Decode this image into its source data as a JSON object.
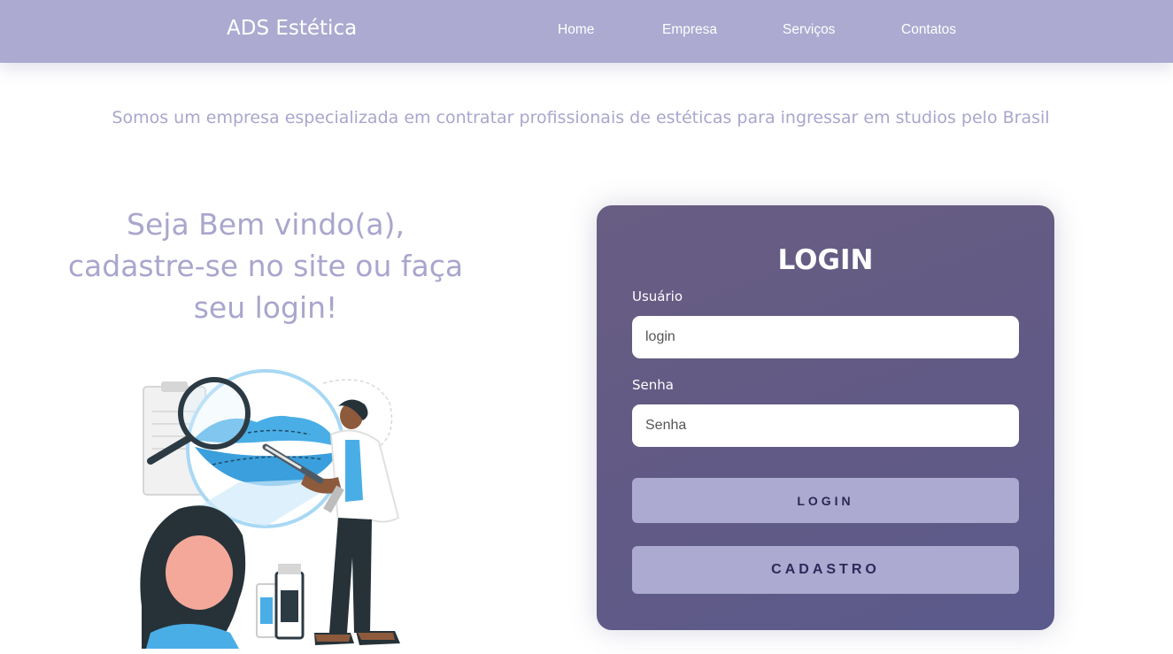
{
  "navbar": {
    "brand": "ADS Estética",
    "links": [
      {
        "label": "Home"
      },
      {
        "label": "Empresa"
      },
      {
        "label": "Serviços"
      },
      {
        "label": "Contatos"
      }
    ]
  },
  "tagline": "Somos um empresa especializada em contratar profissionais de estéticas para ingressar em studios pelo Brasil",
  "welcome": {
    "line1": "Seja Bem vindo(a),",
    "line2": "cadastre-se no site ou faça",
    "line3": "seu login!"
  },
  "login": {
    "title": "LOGIN",
    "user_label": "Usuário",
    "user_placeholder": "login",
    "password_label": "Senha",
    "password_placeholder": "Senha",
    "login_button": "LOGIN",
    "register_button": "CADASTRO"
  },
  "colors": {
    "navbar_bg": "#acaad0",
    "accent_text": "#a9a6cd",
    "card_bg": "#655c85",
    "button_bg": "#acaad0",
    "button_text": "#2c2655"
  },
  "illustration": {
    "icon": "esthetician-lips-illustration"
  }
}
